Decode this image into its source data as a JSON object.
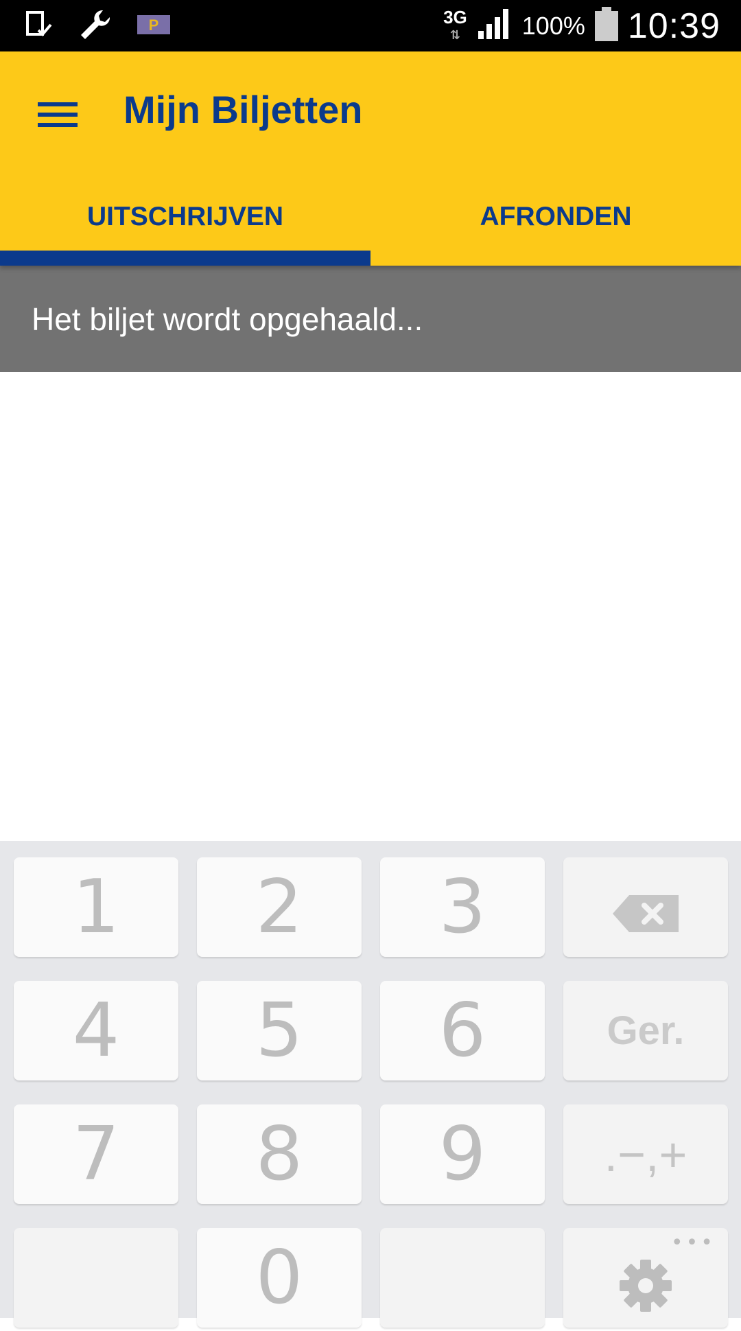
{
  "status_bar": {
    "network": "3G",
    "battery": "100%",
    "time": "10:39"
  },
  "app_bar": {
    "title": "Mijn Biljetten",
    "tabs": [
      {
        "label": "UITSCHRIJVEN",
        "active": true
      },
      {
        "label": "AFRONDEN",
        "active": false
      }
    ],
    "colors": {
      "background": "#FDC918",
      "accent": "#0B3A8C"
    }
  },
  "loading": {
    "message": "Het biljet wordt opgehaald..."
  },
  "keypad": {
    "keys": {
      "k1": "1",
      "k2": "2",
      "k3": "3",
      "k4": "4",
      "k5": "5",
      "k6": "6",
      "k7": "7",
      "k8": "8",
      "k9": "9",
      "k0": "0",
      "done": "Ger.",
      "symbols": ".−,+",
      "more": "•••"
    },
    "icons": {
      "backspace": "backspace-icon",
      "settings": "gear-icon"
    }
  }
}
